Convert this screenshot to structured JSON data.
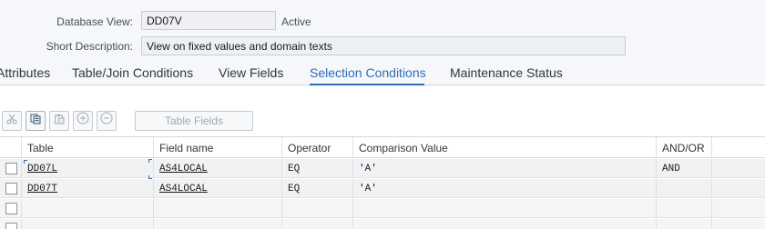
{
  "header": {
    "db_view_label": "Database View:",
    "db_view_value": "DD07V",
    "status": "Active",
    "short_desc_label": "Short Description:",
    "short_desc_value": "View on fixed values and domain texts"
  },
  "tabs": [
    {
      "label": "Attributes"
    },
    {
      "label": "Table/Join Conditions"
    },
    {
      "label": "View Fields"
    },
    {
      "label": "Selection Conditions"
    },
    {
      "label": "Maintenance Status"
    }
  ],
  "active_tab": "Selection Conditions",
  "toolbar": {
    "icons": [
      "cut-icon",
      "copy-icon",
      "paste-icon",
      "add-row-icon",
      "remove-row-icon"
    ],
    "table_fields_label": "Table Fields"
  },
  "grid": {
    "columns": [
      "Table",
      "Field name",
      "Operator",
      "Comparison Value",
      "AND/OR"
    ],
    "rows": [
      {
        "table": "DD07L",
        "field": "AS4LOCAL",
        "operator": "EQ",
        "value": "'A'",
        "andor": "AND"
      },
      {
        "table": "DD07T",
        "field": "AS4LOCAL",
        "operator": "EQ",
        "value": "'A'",
        "andor": ""
      }
    ]
  },
  "colors": {
    "accent": "#2f6fb6",
    "text": "#32363a"
  }
}
